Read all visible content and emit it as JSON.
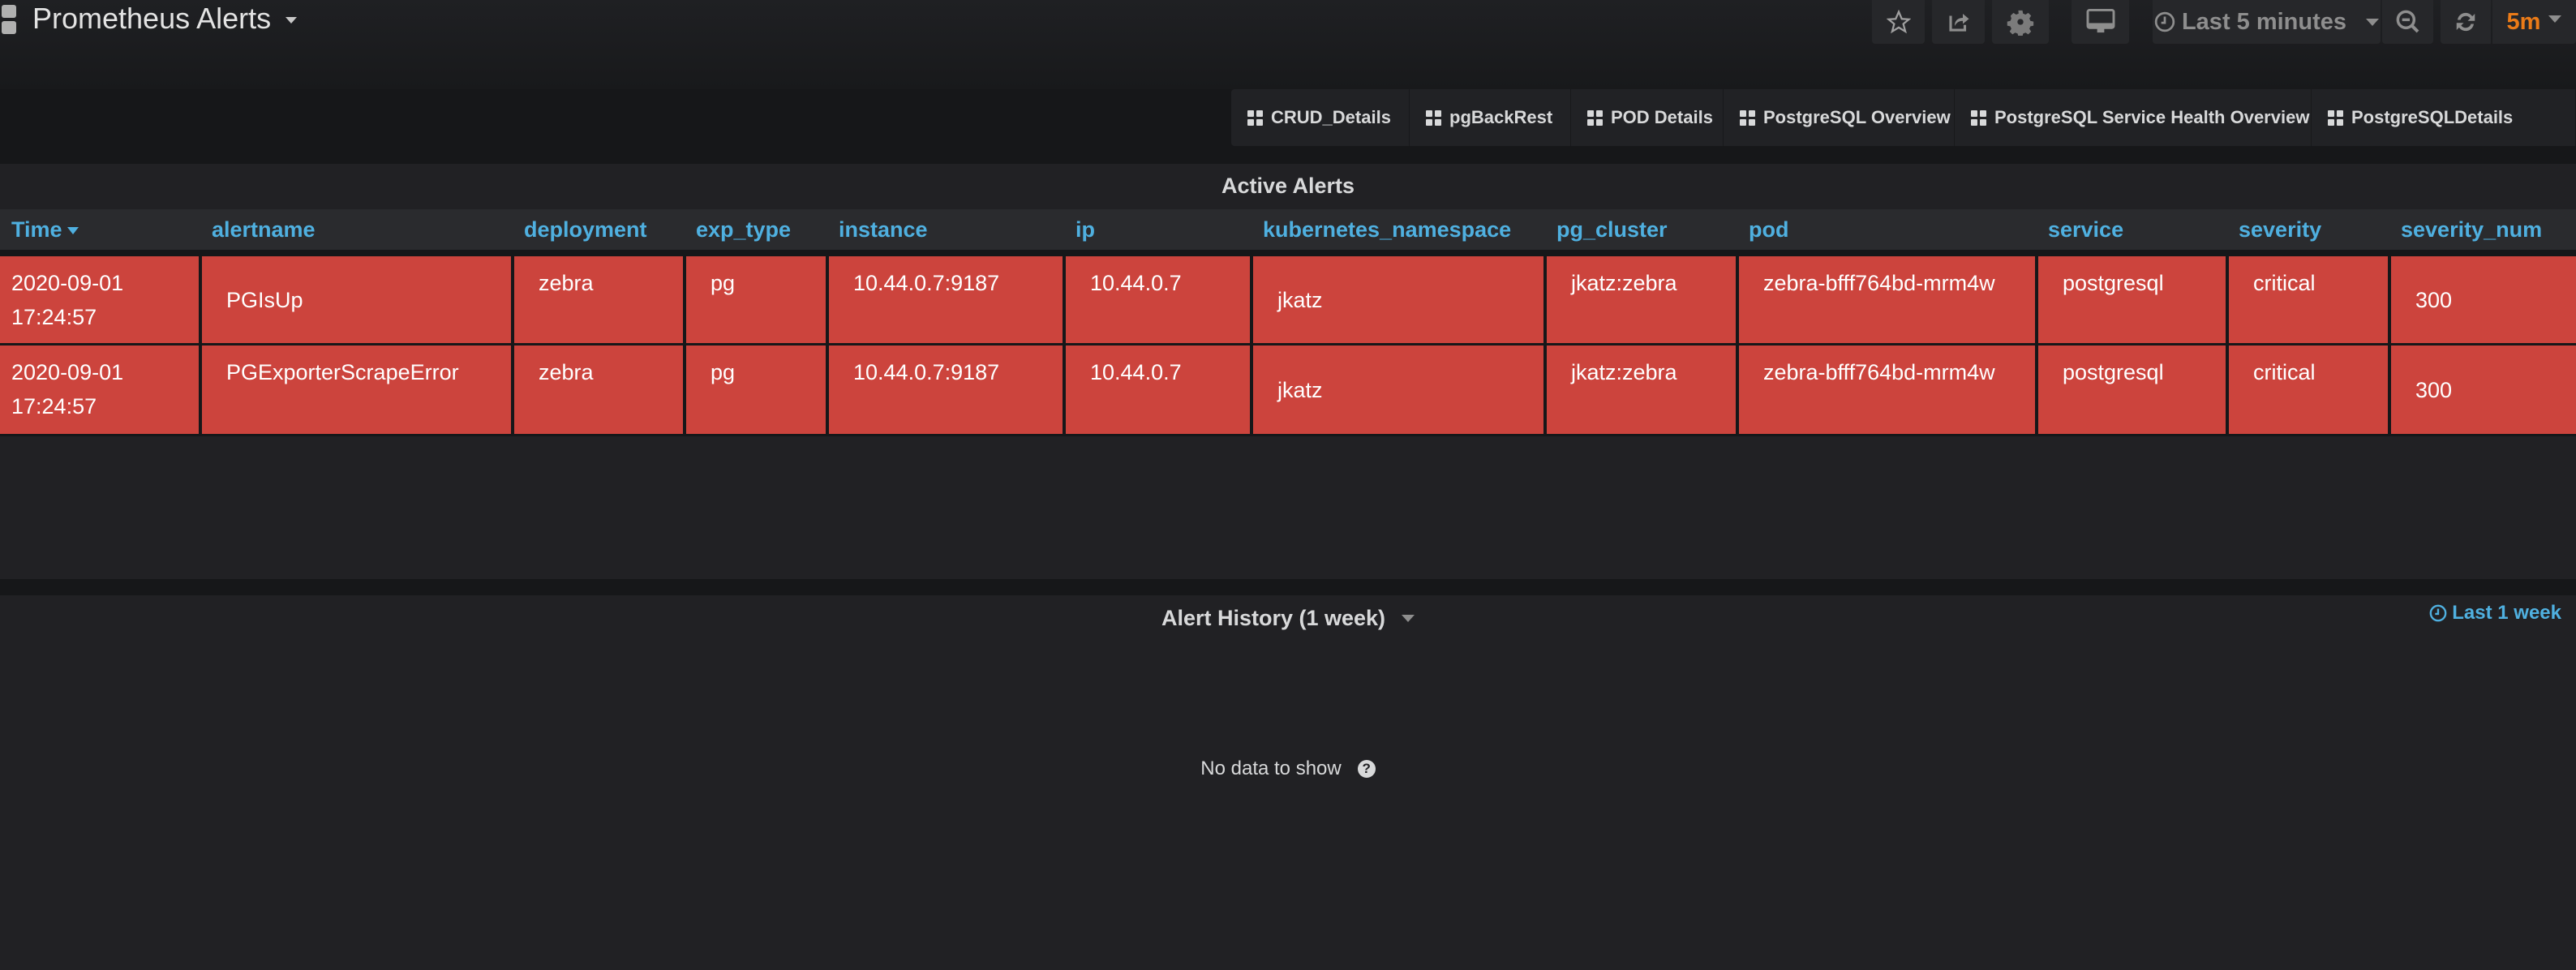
{
  "header": {
    "title": "Prometheus Alerts",
    "buttons": {
      "star": "star-icon",
      "share": "share-icon",
      "settings": "gear-icon",
      "view_mode": "monitor-icon",
      "zoom_out": "zoom-out-icon",
      "refresh": "refresh-icon"
    },
    "time_range": "Last 5 minutes",
    "refresh_interval": "5m"
  },
  "dashboard_links": [
    {
      "label": "CRUD_Details"
    },
    {
      "label": "pgBackRest"
    },
    {
      "label": "POD Details"
    },
    {
      "label": "PostgreSQL Overview"
    },
    {
      "label": "PostgreSQL Service Health Overview"
    },
    {
      "label": "PostgreSQLDetails"
    }
  ],
  "active_alerts": {
    "title": "Active Alerts",
    "columns": [
      "Time",
      "alertname",
      "deployment",
      "exp_type",
      "instance",
      "ip",
      "kubernetes_namespace",
      "pg_cluster",
      "pod",
      "service",
      "severity",
      "severity_num"
    ],
    "sort_column": "Time",
    "row_color": "#cc443d",
    "rows": [
      {
        "time": "2020-09-01 17:24:57",
        "alertname": "PGIsUp",
        "deployment": "zebra",
        "exp_type": "pg",
        "instance": "10.44.0.7:9187",
        "ip": "10.44.0.7",
        "kubernetes_namespace": "jkatz",
        "pg_cluster": "jkatz:zebra",
        "pod": "zebra-bfff764bd-mrm4w",
        "service": "postgresql",
        "severity": "critical",
        "severity_num": "300"
      },
      {
        "time": "2020-09-01 17:24:57",
        "alertname": "PGExporterScrapeError",
        "deployment": "zebra",
        "exp_type": "pg",
        "instance": "10.44.0.7:9187",
        "ip": "10.44.0.7",
        "kubernetes_namespace": "jkatz",
        "pg_cluster": "jkatz:zebra",
        "pod": "zebra-bfff764bd-mrm4w",
        "service": "postgresql",
        "severity": "critical",
        "severity_num": "300"
      }
    ]
  },
  "alert_history": {
    "title": "Alert History (1 week)",
    "time_override": "Last 1 week",
    "empty_message": "No data to show"
  }
}
